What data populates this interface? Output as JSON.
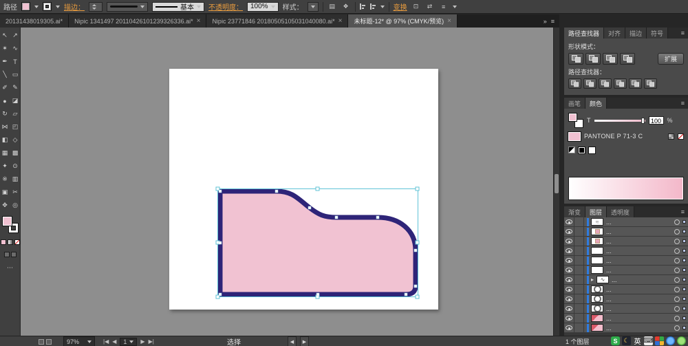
{
  "icons": {
    "close": "×",
    "panel_menu": "≡",
    "expander": "▸",
    "overflow": "»",
    "more": "⋯"
  },
  "control_bar": {
    "path_label": "路径",
    "stroke_link": "描边：",
    "brush_definition": "基本",
    "opacity_link": "不透明度：",
    "opacity_value": "100%",
    "style_label": "样式：",
    "transform_link": "变换"
  },
  "tab_bar": {
    "tabs": [
      {
        "label": "20131438019305.ai*",
        "active": false,
        "closable": false
      },
      {
        "label": "Nipic 1341497 20110426101239326336.ai*",
        "active": false,
        "closable": true
      },
      {
        "label": "Nipic 23771846 20180505105031040080.ai*",
        "active": false,
        "closable": true
      },
      {
        "label": "未标题-12* @ 97% (CMYK/预览)",
        "active": true,
        "closable": true
      }
    ]
  },
  "toolbar": {
    "tools": [
      {
        "name": "selection",
        "glyph": "↖"
      },
      {
        "name": "direct-selection",
        "glyph": "↗"
      },
      {
        "name": "magic-wand",
        "glyph": "✶"
      },
      {
        "name": "lasso",
        "glyph": "∿"
      },
      {
        "name": "pen",
        "glyph": "✒"
      },
      {
        "name": "type",
        "glyph": "T"
      },
      {
        "name": "line",
        "glyph": "╲"
      },
      {
        "name": "rectangle",
        "glyph": "▭"
      },
      {
        "name": "paintbrush",
        "glyph": "✐"
      },
      {
        "name": "pencil",
        "glyph": "✎"
      },
      {
        "name": "blob-brush",
        "glyph": "●"
      },
      {
        "name": "eraser",
        "glyph": "◪"
      },
      {
        "name": "rotate",
        "glyph": "↻"
      },
      {
        "name": "scale",
        "glyph": "▱"
      },
      {
        "name": "width",
        "glyph": "⋈"
      },
      {
        "name": "free-transform",
        "glyph": "◰"
      },
      {
        "name": "shape-builder",
        "glyph": "◧"
      },
      {
        "name": "perspective-grid",
        "glyph": "◇"
      },
      {
        "name": "mesh",
        "glyph": "▦"
      },
      {
        "name": "gradient",
        "glyph": "▩"
      },
      {
        "name": "eyedropper",
        "glyph": "✦"
      },
      {
        "name": "blend",
        "glyph": "⊙"
      },
      {
        "name": "symbol-sprayer",
        "glyph": "※"
      },
      {
        "name": "graph",
        "glyph": "▥"
      },
      {
        "name": "artboard",
        "glyph": "▣"
      },
      {
        "name": "slice",
        "glyph": "✂"
      },
      {
        "name": "hand",
        "glyph": "✥"
      },
      {
        "name": "zoom",
        "glyph": "◎"
      }
    ]
  },
  "canvas": {
    "shape": {
      "fill": "#f1c2d2",
      "stroke": "#2e2478",
      "selection_color": "#5fc3d6"
    }
  },
  "panels": {
    "pathfinder": {
      "tabs": [
        {
          "label": "路径查找器",
          "active": true
        },
        {
          "label": "对齐",
          "active": false
        },
        {
          "label": "描边",
          "active": false
        },
        {
          "label": "符号",
          "active": false
        }
      ],
      "shape_modes_label": "形状模式：",
      "expand_button": "扩展",
      "pathfinder_label": "路径查找器：",
      "shape_mode_buttons": [
        "unite",
        "minus-front",
        "intersect",
        "exclude"
      ],
      "pathfinder_buttons": [
        "divide",
        "trim",
        "merge",
        "crop",
        "outline",
        "minus-back"
      ]
    },
    "color": {
      "tabs": [
        {
          "label": "画笔",
          "active": false
        },
        {
          "label": "颜色",
          "active": true
        }
      ],
      "tint_label": "T",
      "tint_value": "100",
      "tint_unit": "%",
      "swatch_name": "PANTONE P 71-3 C",
      "ramp_from": "#ffffff",
      "ramp_to": "#f3b7c9"
    },
    "layers": {
      "tabs": [
        {
          "label": "渐变",
          "active": false
        },
        {
          "label": "图层",
          "active": true
        },
        {
          "label": "透明度",
          "active": false
        }
      ],
      "rows": [
        {
          "name": "...",
          "thumb": "marks",
          "expander": false
        },
        {
          "name": "...",
          "thumb": "mark-pink",
          "expander": false
        },
        {
          "name": "...",
          "thumb": "mark-pink",
          "expander": false
        },
        {
          "name": "...",
          "thumb": "blank",
          "expander": false
        },
        {
          "name": "...",
          "thumb": "blank",
          "expander": false
        },
        {
          "name": "...",
          "thumb": "blank",
          "expander": false
        },
        {
          "name": "...",
          "thumb": "squiggle",
          "expander": true
        },
        {
          "name": "...",
          "thumb": "circle",
          "expander": false
        },
        {
          "name": "...",
          "thumb": "circle",
          "expander": false
        },
        {
          "name": "...",
          "thumb": "circle",
          "expander": false
        },
        {
          "name": "...",
          "thumb": "multi",
          "expander": false
        },
        {
          "name": "...",
          "thumb": "multi",
          "expander": false
        }
      ],
      "count_label": "1 个图层"
    }
  },
  "status_bar": {
    "zoom_value": "97%",
    "nav_first": "|◀",
    "nav_prev": "◀",
    "artboard_value": "1",
    "nav_next": "▶",
    "nav_last": "▶|",
    "tool_status": "选择",
    "scroll_left": "◀",
    "scroll_right": "▶"
  },
  "tray": {
    "sogou_label": "S",
    "moon_glyph": "☾",
    "ime_label": "英",
    "keyboard_glyph": "⌨"
  }
}
